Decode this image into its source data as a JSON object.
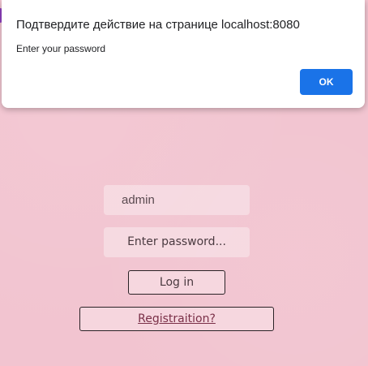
{
  "dialog": {
    "title": "Подтвердите действие на странице localhost:8080",
    "message": "Enter your password",
    "ok_label": "OK"
  },
  "form": {
    "username_value": "admin",
    "password_placeholder": "Enter password...",
    "login_label": "Log in",
    "registration_label": "Registraition?"
  },
  "colors": {
    "page_background": "#f2c4d0",
    "dialog_button": "#1a73e8",
    "registration_link": "#7a3048"
  }
}
